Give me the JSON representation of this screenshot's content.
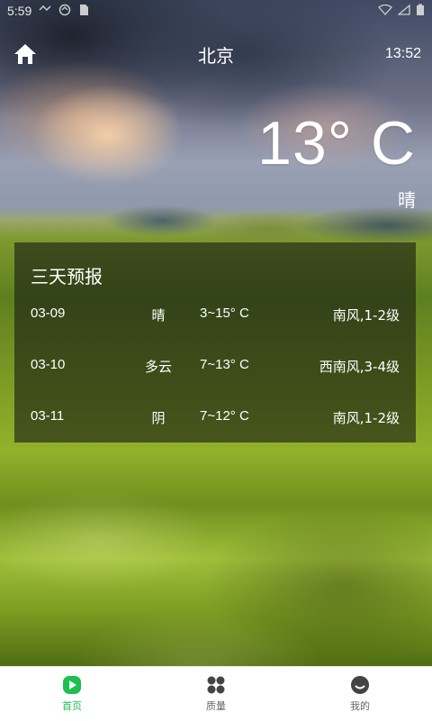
{
  "status_bar": {
    "time": "5:59"
  },
  "header": {
    "city": "北京",
    "time": "13:52"
  },
  "current": {
    "temperature": "13° C",
    "condition": "晴"
  },
  "forecast": {
    "title": "三天预报",
    "days": [
      {
        "date": "03-09",
        "condition": "晴",
        "temp": "3~15° C",
        "wind": "南风,1-2级"
      },
      {
        "date": "03-10",
        "condition": "多云",
        "temp": "7~13° C",
        "wind": "西南风,3-4级"
      },
      {
        "date": "03-11",
        "condition": "阴",
        "temp": "7~12° C",
        "wind": "南风,1-2级"
      }
    ]
  },
  "bottom_nav": {
    "items": [
      {
        "label": "首页",
        "icon": "home-tab-icon",
        "active": true
      },
      {
        "label": "质量",
        "icon": "grid-icon",
        "active": false
      },
      {
        "label": "我的",
        "icon": "profile-icon",
        "active": false
      }
    ],
    "active_color": "#1dbf4e",
    "inactive_color": "#444444"
  }
}
